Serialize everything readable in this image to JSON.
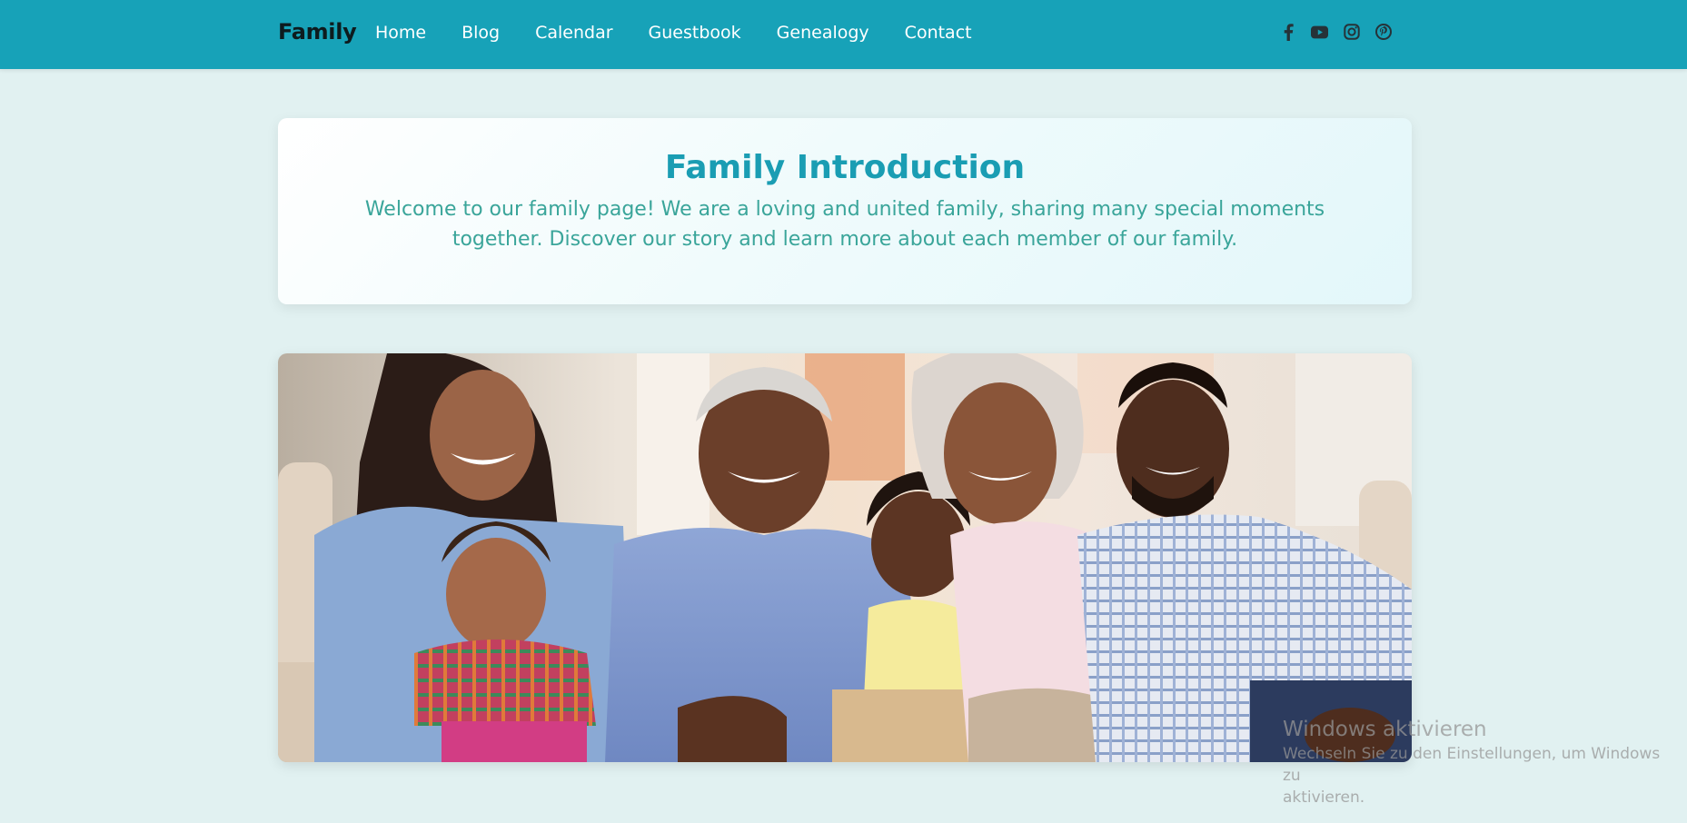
{
  "nav": {
    "brand": "Family",
    "links": [
      "Home",
      "Blog",
      "Calendar",
      "Guestbook",
      "Genealogy",
      "Contact"
    ],
    "social_icons": [
      "facebook-icon",
      "youtube-icon",
      "instagram-icon",
      "pinterest-icon"
    ]
  },
  "intro": {
    "title": "Family Introduction",
    "text": "Welcome to our family page! We are a loving and united family, sharing many special moments together. Discover our story and learn more about each member of our family."
  },
  "watermark": {
    "title": "Windows aktivieren",
    "subtitle_line1": "Wechseln Sie zu den Einstellungen, um Windows zu",
    "subtitle_line2": "aktivieren."
  },
  "colors": {
    "navbar": "#17a2b8",
    "page_background": "#e1f1f1",
    "title": "#1a9db3",
    "intro_text": "#3aa59a"
  }
}
